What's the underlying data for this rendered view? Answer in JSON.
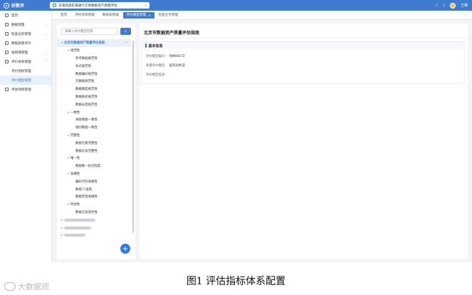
{
  "app": {
    "name": "好数评"
  },
  "topbar": {
    "project": "深海高速车辆通行交易数据资产质量评估",
    "user": "王维"
  },
  "sidebar": {
    "items": [
      {
        "label": "首页"
      },
      {
        "label": "数据管理"
      },
      {
        "label": "检查任务管理"
      },
      {
        "label": "数据质量评价"
      },
      {
        "label": "规则库管理"
      },
      {
        "label": "评价体系管理"
      },
      {
        "label": "评价指标管理"
      },
      {
        "label": "评价模型管理"
      },
      {
        "label": "评估项目管理"
      }
    ]
  },
  "tabs": [
    {
      "label": "首页"
    },
    {
      "label": "评估项目管理"
    },
    {
      "label": "数据表管理"
    },
    {
      "label": "评价模型管理"
    },
    {
      "label": "检查任务管理"
    }
  ],
  "tree": {
    "search_placeholder": "请输入评价模型名称",
    "root": "北京市数据资产质量评估指南",
    "nodes": [
      {
        "label": "规范性",
        "level": 1
      },
      {
        "label": "参考数据规范性",
        "level": 2
      },
      {
        "label": "命名规范性",
        "level": 2
      },
      {
        "label": "数据编码规范性",
        "level": 2
      },
      {
        "label": "元数据规范性",
        "level": 2
      },
      {
        "label": "数据精度规范性",
        "level": 2
      },
      {
        "label": "数据格式规范性",
        "level": 2
      },
      {
        "label": "数据长度规范性",
        "level": 2
      },
      {
        "label": "一致性",
        "level": 1
      },
      {
        "label": "关联数据一致性",
        "level": 2
      },
      {
        "label": "相同数据一致性",
        "level": 2
      },
      {
        "label": "完整性",
        "level": 1
      },
      {
        "label": "数据元素完整性",
        "level": 2
      },
      {
        "label": "数据记录完整性",
        "level": 2
      },
      {
        "label": "唯一性",
        "level": 1
      },
      {
        "label": "数据唯一标识程度",
        "level": 2
      },
      {
        "label": "准确性",
        "level": 1
      },
      {
        "label": "编码代码准确性",
        "level": 2
      },
      {
        "label": "数据71准性",
        "level": 2
      },
      {
        "label": "数据范围准确性",
        "level": 2
      },
      {
        "label": "时效性",
        "level": 1
      },
      {
        "label": "数据记录及时性",
        "level": 2
      }
    ]
  },
  "detail": {
    "title": "北京市数据资产质量评估指南",
    "section": "基本信息",
    "fields": [
      {
        "label": "评价模型编号：",
        "value": "PJMX0172"
      },
      {
        "label": "质量评价模型：",
        "value": "层次分析法"
      },
      {
        "label": "评价模型描述：",
        "value": ""
      }
    ]
  },
  "caption": "图1  评估指标体系配置",
  "watermark": "大数据观"
}
